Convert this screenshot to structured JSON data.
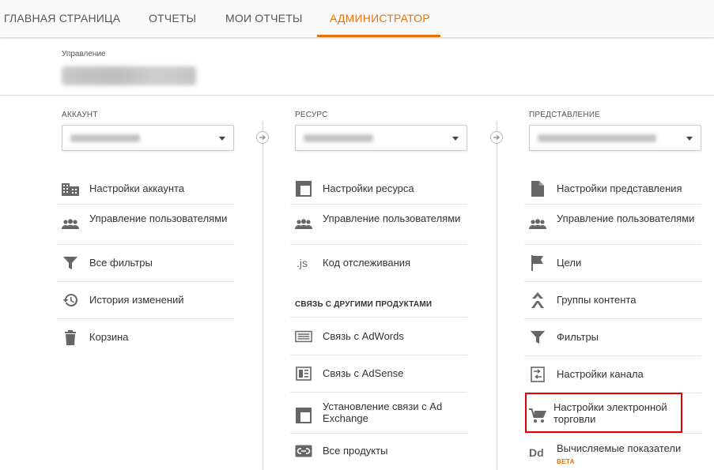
{
  "nav": {
    "tabs": [
      {
        "label": "ГЛАВНАЯ СТРАНИЦА"
      },
      {
        "label": "ОТЧЕТЫ"
      },
      {
        "label": "МОИ ОТЧЕТЫ"
      },
      {
        "label": "АДМИНИСТРАТОР"
      }
    ],
    "active_tab": "АДМИНИСТРАТОР",
    "accent_color": "#e8710a"
  },
  "header": {
    "management_label": "Управление"
  },
  "account": {
    "title": "АККАУНТ",
    "items": [
      {
        "label": "Настройки аккаунта",
        "icon": "building-icon"
      },
      {
        "label": "Управление пользователями",
        "icon": "users-icon"
      },
      {
        "label": "Все фильтры",
        "icon": "filter-icon"
      },
      {
        "label": "История изменений",
        "icon": "history-icon"
      },
      {
        "label": "Корзина",
        "icon": "trash-icon"
      }
    ]
  },
  "property": {
    "title": "РЕСУРС",
    "items": [
      {
        "label": "Настройки ресурса",
        "icon": "property-settings-icon"
      },
      {
        "label": "Управление пользователями",
        "icon": "users-icon"
      },
      {
        "label": "Код отслеживания",
        "icon": "js-icon"
      }
    ],
    "products_title": "СВЯЗЬ С ДРУГИМИ ПРОДУКТАМИ",
    "product_items": [
      {
        "label": "Связь с AdWords",
        "icon": "adwords-icon"
      },
      {
        "label": "Связь с AdSense",
        "icon": "adsense-icon"
      },
      {
        "label": "Установление связи с Ad Exchange",
        "icon": "ad-exchange-icon"
      },
      {
        "label": "Все продукты",
        "icon": "link-icon"
      }
    ]
  },
  "view": {
    "title": "ПРЕДСТАВЛЕНИЕ",
    "items": [
      {
        "label": "Настройки представления",
        "icon": "document-icon"
      },
      {
        "label": "Управление пользователями",
        "icon": "users-icon"
      },
      {
        "label": "Цели",
        "icon": "flag-icon"
      },
      {
        "label": "Группы контента",
        "icon": "content-group-icon"
      },
      {
        "label": "Фильтры",
        "icon": "filter-icon"
      },
      {
        "label": "Настройки канала",
        "icon": "channel-icon"
      },
      {
        "label": "Настройки электронной торговли",
        "icon": "cart-icon"
      },
      {
        "label": "Вычисляемые показатели",
        "icon": "dd-icon",
        "badge": "BETA"
      }
    ]
  },
  "highlight_color": "#e00000"
}
